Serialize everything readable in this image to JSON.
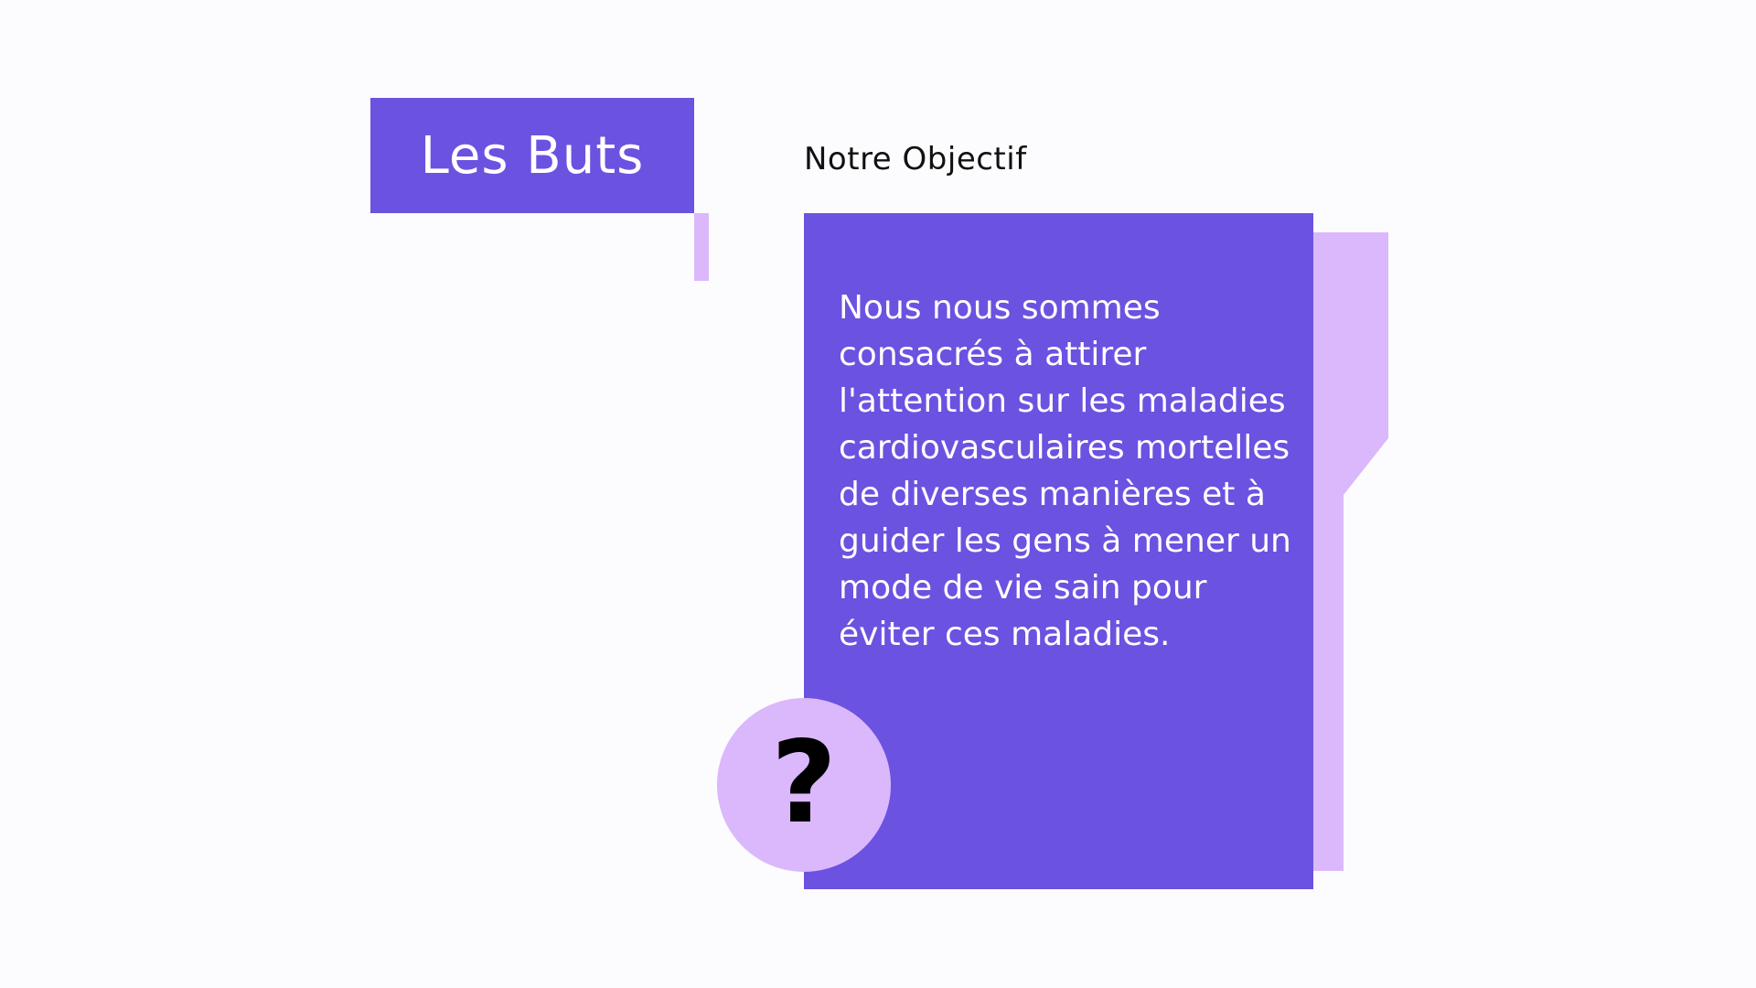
{
  "slide": {
    "title": "Les Buts",
    "subtitle": "Notre Objectif",
    "body": "Nous nous sommes consacrés à attirer l'attention sur les maladies cardiovasculaires mortelles de diverses manières et à guider les gens à mener un mode de vie sain pour éviter ces maladies.",
    "icon": "question-mark-icon"
  },
  "colors": {
    "primary": "#6c52e0",
    "accent": "#dab8fb",
    "background": "#fcfcfe",
    "text_dark": "#111111",
    "text_light": "#ffffff"
  }
}
